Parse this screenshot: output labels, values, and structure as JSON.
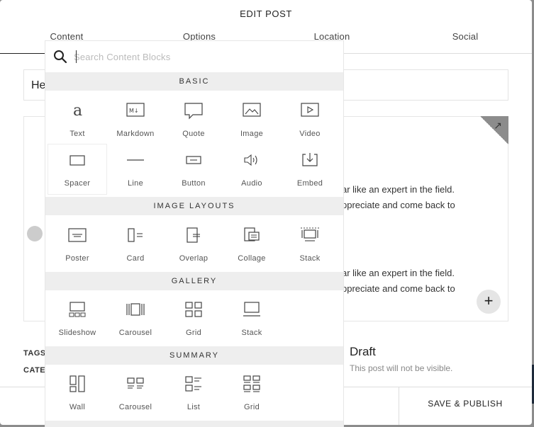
{
  "dialog": {
    "title": "EDIT POST",
    "tabs": [
      {
        "label": "Content"
      },
      {
        "label": "Options"
      },
      {
        "label": "Location"
      },
      {
        "label": "Social"
      }
    ],
    "title_field_value": "He",
    "editor_lines": [
      "ar like an expert in the field.",
      "ppreciate and come back to",
      "ar like an expert in the field.",
      "ppreciate and come back to"
    ],
    "add_icon": "+",
    "expand_icon": "↗",
    "tags_label": "TAGS",
    "categories_label": "CATEG",
    "status_title": "Draft",
    "status_sub": "This post will not be visible.",
    "save_label": "SAVE & PUBLISH"
  },
  "picker": {
    "search_placeholder": "Search Content Blocks",
    "sections": [
      {
        "title": "BASIC",
        "items": [
          {
            "label": "Text",
            "icon": "text-icon"
          },
          {
            "label": "Markdown",
            "icon": "markdown-icon"
          },
          {
            "label": "Quote",
            "icon": "quote-icon"
          },
          {
            "label": "Image",
            "icon": "image-icon"
          },
          {
            "label": "Video",
            "icon": "video-icon"
          },
          {
            "label": "Spacer",
            "icon": "spacer-icon"
          },
          {
            "label": "Line",
            "icon": "line-icon"
          },
          {
            "label": "Button",
            "icon": "button-icon"
          },
          {
            "label": "Audio",
            "icon": "audio-icon"
          },
          {
            "label": "Embed",
            "icon": "embed-icon"
          }
        ]
      },
      {
        "title": "IMAGE LAYOUTS",
        "items": [
          {
            "label": "Poster",
            "icon": "poster-icon"
          },
          {
            "label": "Card",
            "icon": "card-icon"
          },
          {
            "label": "Overlap",
            "icon": "overlap-icon"
          },
          {
            "label": "Collage",
            "icon": "collage-icon"
          },
          {
            "label": "Stack",
            "icon": "stack-icon"
          }
        ]
      },
      {
        "title": "GALLERY",
        "items": [
          {
            "label": "Slideshow",
            "icon": "slideshow-icon"
          },
          {
            "label": "Carousel",
            "icon": "carousel-icon"
          },
          {
            "label": "Grid",
            "icon": "grid-icon"
          },
          {
            "label": "Stack",
            "icon": "gallery-stack-icon"
          }
        ]
      },
      {
        "title": "SUMMARY",
        "items": [
          {
            "label": "Wall",
            "icon": "wall-icon"
          },
          {
            "label": "Carousel",
            "icon": "summary-carousel-icon"
          },
          {
            "label": "List",
            "icon": "list-icon"
          },
          {
            "label": "Grid",
            "icon": "summary-grid-icon"
          }
        ]
      }
    ]
  }
}
